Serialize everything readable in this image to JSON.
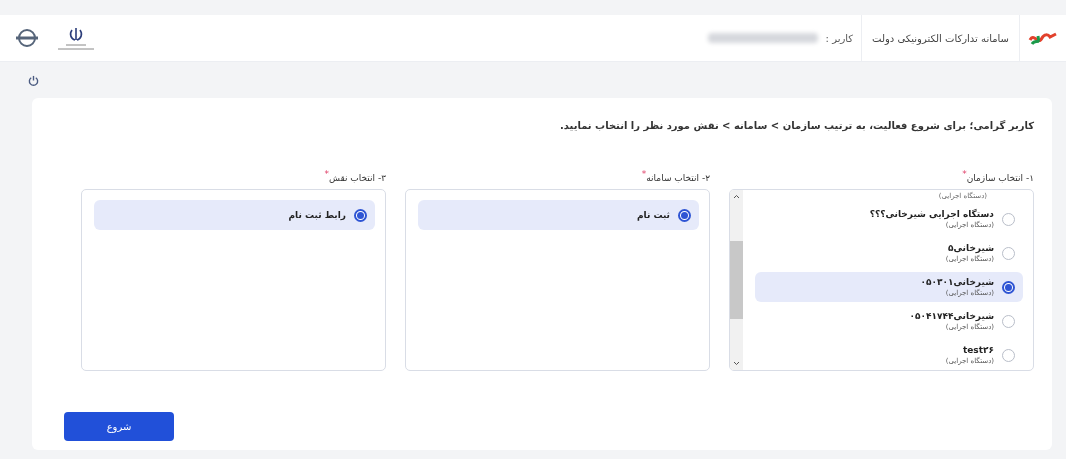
{
  "header": {
    "system_title": "سامانه تدارکات الکترونیکی دولت",
    "user_label": "کاربر :"
  },
  "intro": "کاربر گرامی؛ برای شروع فعالیت، به ترتیب سازمان > سامانه > نقش مورد نظر را انتخاب نمایید.",
  "columns": [
    {
      "label": "۱- انتخاب سازمان",
      "required_mark": "*",
      "scrollable": true,
      "top_fragment": "(دستگاه اجرایی)",
      "items": [
        {
          "title": "دستگاه اجرایی شیرخانی؟؟؟",
          "subtitle": "(دستگاه اجرایی)",
          "selected": false
        },
        {
          "title": "شیرخانی۵",
          "subtitle": "(دستگاه اجرایی)",
          "selected": false
        },
        {
          "title": "شیرخانی۰۵۰۳۰۱",
          "subtitle": "(دستگاه اجرایی)",
          "selected": true
        },
        {
          "title": "شیرخانی۰۵۰۴۱۷۴۴",
          "subtitle": "(دستگاه اجرایی)",
          "selected": false
        },
        {
          "title": "test۲۶",
          "subtitle": "(دستگاه اجرایی)",
          "selected": false
        }
      ]
    },
    {
      "label": "۲- انتخاب سامانه",
      "required_mark": "*",
      "scrollable": false,
      "items": [
        {
          "title": "ثبت نام",
          "selected": true
        }
      ]
    },
    {
      "label": "۳- انتخاب نقش",
      "required_mark": "*",
      "scrollable": false,
      "items": [
        {
          "title": "رابط ثبت نام",
          "selected": true
        }
      ]
    }
  ],
  "start_button": "شروع"
}
